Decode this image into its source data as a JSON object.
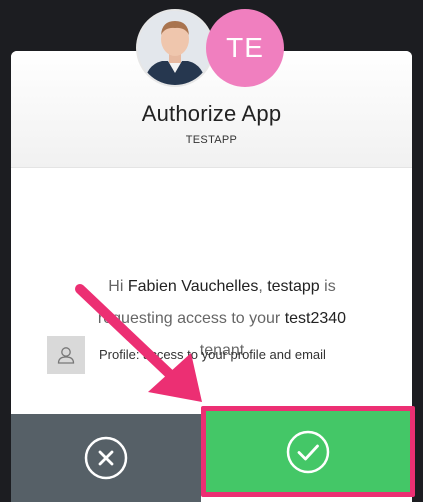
{
  "dialog": {
    "title": "Authorize App",
    "app_name": "TESTAPP",
    "app_initials": "TE",
    "message": {
      "prefix": "Hi ",
      "user_name": "Fabien Vauchelles",
      "app_ref": "testapp",
      "middle": ", testapp is requesting access to your ",
      "tenant": "test2340",
      "suffix": " tenant"
    },
    "permissions": [
      {
        "icon": "user-icon",
        "label": "Profile:",
        "description": "access to your profile and email"
      }
    ]
  },
  "actions": {
    "deny_icon": "close-circle-icon",
    "allow_icon": "check-circle-icon"
  },
  "colors": {
    "background": "#1c1d21",
    "app_avatar": "#f07fbf",
    "deny_button": "#566067",
    "allow_button": "#44c767",
    "highlight": "#ec2f73"
  }
}
